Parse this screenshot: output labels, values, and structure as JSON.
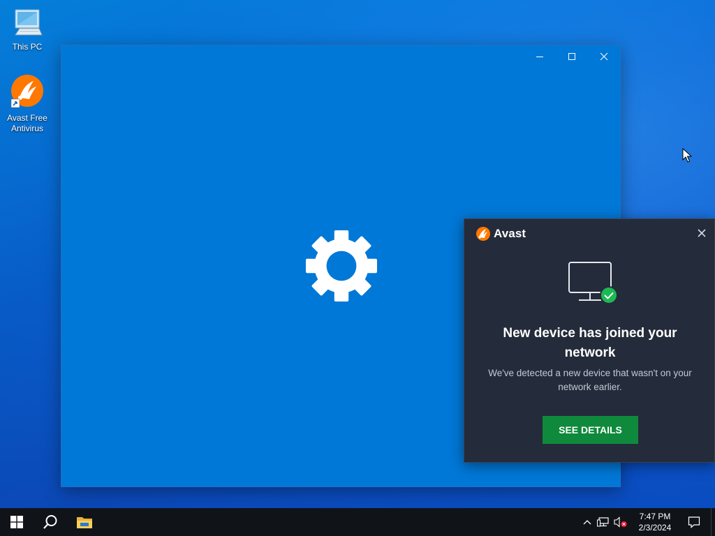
{
  "desktop": {
    "icons": [
      {
        "label": "This PC",
        "icon": "this-pc-icon"
      },
      {
        "label": "Avast Free Antivirus",
        "icon": "avast-icon"
      }
    ]
  },
  "settings_window": {
    "controls": [
      "minimize-icon",
      "maximize-icon",
      "close-icon"
    ],
    "loading_icon": "gear-icon",
    "background": "#0078d7"
  },
  "avast_popup": {
    "brand": "Avast",
    "title": "New device has joined your network",
    "body": "We've detected a new device that wasn't on your network earlier.",
    "button_label": "SEE DETAILS",
    "accent": "#ff7800",
    "button_color": "#0f8a3c"
  },
  "taskbar": {
    "start_icon": "windows-start-icon",
    "search_icon": "search-icon",
    "pinned": [
      "file-explorer-icon"
    ],
    "tray_icons": [
      "chevron-up-icon",
      "network-icon",
      "volume-muted-icon"
    ],
    "time": "7:47 PM",
    "date": "2/3/2024",
    "notification_icon": "action-center-icon"
  }
}
